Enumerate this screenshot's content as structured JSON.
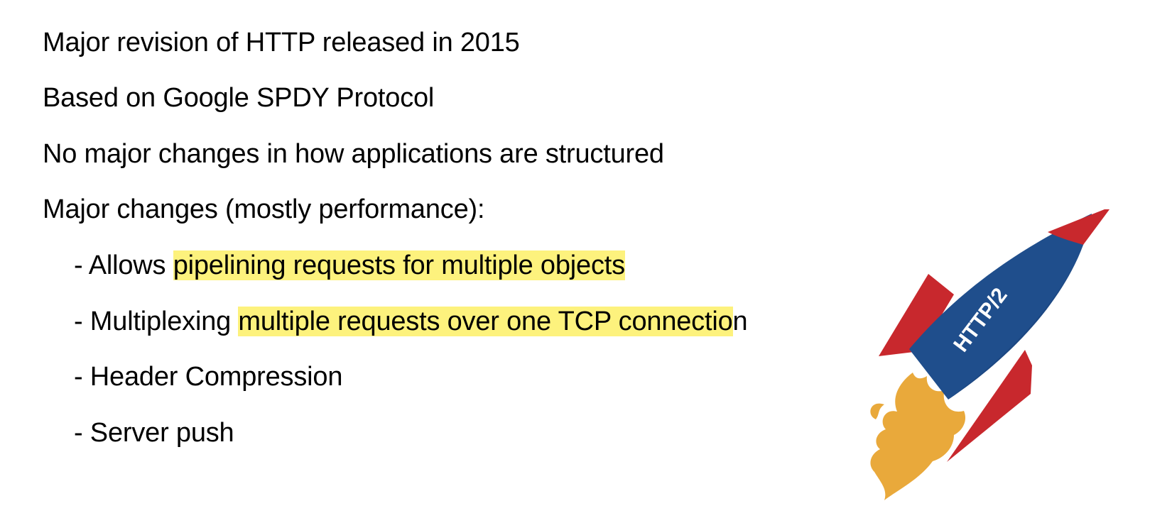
{
  "lines": [
    {
      "text": "Major revision of HTTP released in 2015"
    },
    {
      "text": "Based on Google SPDY Protocol"
    },
    {
      "text": "No major changes in how applications are structured"
    },
    {
      "text": "Major changes (mostly performance):"
    }
  ],
  "bullets": [
    {
      "prefix": "- Allows ",
      "highlight": "pipelining requests for multiple objects",
      "suffix": ""
    },
    {
      "prefix": "- Multiplexing ",
      "highlight": "multiple requests over one TCP connectio",
      "suffix": "n"
    },
    {
      "prefix": "- Header Compression",
      "highlight": "",
      "suffix": ""
    },
    {
      "prefix": "- Server push",
      "highlight": "",
      "suffix": ""
    }
  ],
  "graphic": {
    "icon": "rocket-icon",
    "label": "HTTP/2",
    "colors": {
      "body": "#1f4e8c",
      "fins": "#c8282d",
      "flame": "#e9a93b",
      "highlight": "#fdf27d"
    }
  }
}
